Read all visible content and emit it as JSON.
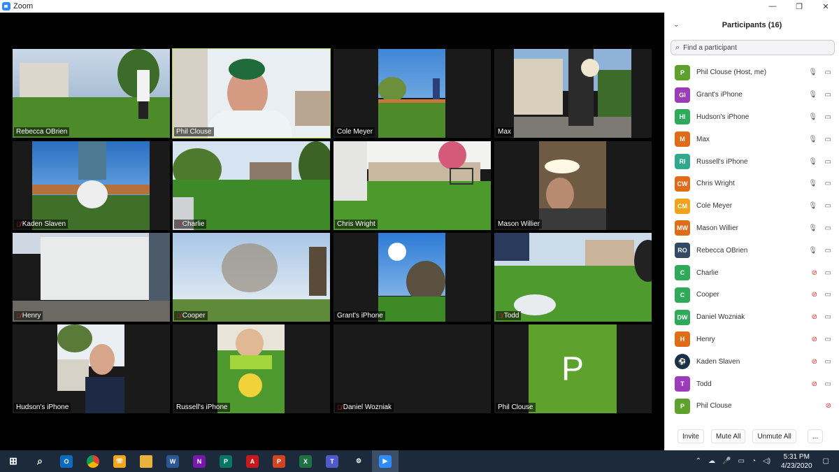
{
  "window": {
    "title": "Zoom",
    "controls": [
      "—",
      "❐",
      "✕"
    ]
  },
  "video_tiles": [
    {
      "name": "Rebecca OBrien",
      "muted": false,
      "active": false
    },
    {
      "name": "Phil Clouse",
      "muted": false,
      "active": true
    },
    {
      "name": "Cole Meyer",
      "muted": false,
      "active": false
    },
    {
      "name": "Max",
      "muted": false,
      "active": false
    },
    {
      "name": "Kaden Slaven",
      "muted": true,
      "active": false
    },
    {
      "name": "Charlie",
      "muted": true,
      "active": false
    },
    {
      "name": "Chris Wright",
      "muted": false,
      "active": false
    },
    {
      "name": "Mason Willier",
      "muted": false,
      "active": false
    },
    {
      "name": "Henry",
      "muted": true,
      "active": false
    },
    {
      "name": "Cooper",
      "muted": true,
      "active": false
    },
    {
      "name": "Grant's iPhone",
      "muted": false,
      "active": false
    },
    {
      "name": "Todd",
      "muted": true,
      "active": false
    },
    {
      "name": "Hudson's iPhone",
      "muted": false,
      "active": false
    },
    {
      "name": "Russell's iPhone",
      "muted": false,
      "active": false
    },
    {
      "name": "Daniel Wozniak",
      "muted": true,
      "active": false
    },
    {
      "name": "Phil Clouse",
      "muted": false,
      "active": false,
      "letter": "P"
    }
  ],
  "panel": {
    "title": "Participants (16)",
    "search_placeholder": "Find a participant",
    "participants": [
      {
        "initials": "P",
        "name": "Phil Clouse (Host, me)",
        "color": "#5fa12d",
        "mic": "on",
        "cam": "on"
      },
      {
        "initials": "GI",
        "name": "Grant's iPhone",
        "color": "#9b3db8",
        "mic": "on",
        "cam": "on"
      },
      {
        "initials": "HI",
        "name": "Hudson's iPhone",
        "color": "#2eaa5a",
        "mic": "on",
        "cam": "on"
      },
      {
        "initials": "M",
        "name": "Max",
        "color": "#e06b19",
        "mic": "on",
        "cam": "on"
      },
      {
        "initials": "RI",
        "name": "Russell's iPhone",
        "color": "#2ea88f",
        "mic": "on",
        "cam": "on"
      },
      {
        "initials": "CW",
        "name": "Chris Wright",
        "color": "#e06b19",
        "mic": "on",
        "cam": "on"
      },
      {
        "initials": "CM",
        "name": "Cole Meyer",
        "color": "#f2a21b",
        "mic": "on",
        "cam": "on"
      },
      {
        "initials": "MW",
        "name": "Mason Willier",
        "color": "#e06b19",
        "mic": "on",
        "cam": "on"
      },
      {
        "initials": "RO",
        "name": "Rebecca OBrien",
        "color": "#334a66",
        "mic": "on",
        "cam": "on"
      },
      {
        "initials": "C",
        "name": "Charlie",
        "color": "#2eaa5a",
        "mic": "off",
        "cam": "on"
      },
      {
        "initials": "C",
        "name": "Cooper",
        "color": "#2eaa5a",
        "mic": "off",
        "cam": "on"
      },
      {
        "initials": "DW",
        "name": "Daniel Wozniak",
        "color": "#2eaa5a",
        "mic": "off",
        "cam": "on"
      },
      {
        "initials": "H",
        "name": "Henry",
        "color": "#e06b19",
        "mic": "off",
        "cam": "on"
      },
      {
        "initials": "",
        "name": "Kaden Slaven",
        "color": "#1a2f4a",
        "mic": "off",
        "cam": "on",
        "logo": true
      },
      {
        "initials": "T",
        "name": "Todd",
        "color": "#9b3db8",
        "mic": "off",
        "cam": "on"
      },
      {
        "initials": "P",
        "name": "Phil Clouse",
        "color": "#5fa12d",
        "mic": "none",
        "cam": "off"
      }
    ],
    "buttons": {
      "invite": "Invite",
      "mute_all": "Mute All",
      "unmute_all": "Unmute All",
      "more": "..."
    }
  },
  "taskbar": {
    "apps": [
      {
        "name": "start",
        "label": "",
        "color": "#1c2a3b"
      },
      {
        "name": "search",
        "label": "",
        "color": "#1c2a3b"
      },
      {
        "name": "outlook",
        "label": "O",
        "color": "#0f6cbd"
      },
      {
        "name": "chrome",
        "label": "",
        "color": "#1c2a3b"
      },
      {
        "name": "phone",
        "label": "☏",
        "color": "#f3a51b"
      },
      {
        "name": "file-explorer",
        "label": "",
        "color": "#e9b23d"
      },
      {
        "name": "word",
        "label": "W",
        "color": "#2b5797"
      },
      {
        "name": "onenote",
        "label": "N",
        "color": "#7719aa"
      },
      {
        "name": "publisher",
        "label": "P",
        "color": "#077568"
      },
      {
        "name": "acrobat",
        "label": "A",
        "color": "#c8191e"
      },
      {
        "name": "powerpoint",
        "label": "P",
        "color": "#d04423"
      },
      {
        "name": "excel",
        "label": "X",
        "color": "#1e7145"
      },
      {
        "name": "teams",
        "label": "T",
        "color": "#5059c9"
      },
      {
        "name": "settings",
        "label": "⚙",
        "color": "#1c2a3b"
      },
      {
        "name": "zoom",
        "label": "▶",
        "color": "#2d8cff",
        "active": true
      }
    ],
    "time": "5:31 PM",
    "date": "4/23/2020"
  }
}
